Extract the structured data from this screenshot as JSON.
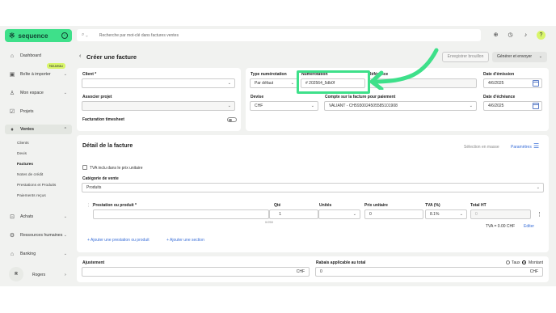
{
  "brand": {
    "logo_mark": "※",
    "name": "sequence"
  },
  "search": {
    "placeholder": "Recherche par mot-clé dans factures ventes"
  },
  "sidebar": {
    "new_badge": "Nouveau",
    "items": [
      {
        "label": "Dashboard",
        "icon": "home-icon"
      },
      {
        "label": "Boîte à importer",
        "icon": "inbox-icon"
      },
      {
        "label": "Mon espace",
        "icon": "user-icon"
      },
      {
        "label": "Projets",
        "icon": "check-square-icon"
      },
      {
        "label": "Ventes",
        "icon": "money-bag-icon"
      },
      {
        "label": "Achats",
        "icon": "cart-icon"
      },
      {
        "label": "Ressources humaines",
        "icon": "people-icon"
      },
      {
        "label": "Banking",
        "icon": "bank-icon"
      }
    ],
    "subitems": [
      "Clients",
      "Devis",
      "Factures",
      "Notes de crédit",
      "Prestations et Produits",
      "Paiements reçus"
    ],
    "user": {
      "initials": "R",
      "name": "Rogers"
    }
  },
  "header": {
    "title": "Créer une facture",
    "save_draft": "Enregistrer brouillon",
    "generate_send": "Générer et envoyer"
  },
  "form": {
    "client_label": "Client *",
    "associate_label": "Associer projet",
    "timesheet_label": "Facturation timesheet",
    "numbering_type_label": "Type numérotation",
    "numbering_type_value": "Par défaut",
    "numbering_label": "Numérotation",
    "numbering_value": "# 202564_5db0f",
    "reference_label": "Référence",
    "issue_date_label": "Date d'émission",
    "issue_date": "4/6/2025",
    "currency_label": "Devise",
    "currency_value": "CHF",
    "account_label": "Compte sur la facture pour paiement",
    "account_value": "VALIANT - CH5930024505585101908",
    "due_date_label": "Date d'échéance",
    "due_date": "4/6/2025"
  },
  "detail": {
    "title": "Détail de la facture",
    "bulk_select": "Sélection en masse",
    "settings": "Paramètres",
    "vat_included": "TVA inclu dans le prix unitaire",
    "sale_category_label": "Catégorie de vente",
    "sale_category_value": "Produits",
    "columns": [
      "Prestation ou produit *",
      "Qté",
      "Unités",
      "Prix unitaire",
      "TVA (%)",
      "Total HT"
    ],
    "row": {
      "qty": "1",
      "qty_hint": "0/250",
      "unit_price": "0",
      "vat": "8.1%",
      "total": "0"
    },
    "vat_total": "TVA = 0.00 CHF",
    "edit": "Editer",
    "add_item": "Ajouter une prestation ou produit",
    "add_section": "Ajouter une section"
  },
  "footer": {
    "adjustment_label": "Ajustement",
    "adjustment_currency": "CHF",
    "discount_label": "Rabais applicable au total",
    "discount_value": "0",
    "discount_currency": "CHF",
    "rate_label": "Taux",
    "amount_label": "Montant"
  },
  "colors": {
    "brand": "#3ee08a",
    "link": "#3a6fd8",
    "badge": "#d8f56a"
  }
}
